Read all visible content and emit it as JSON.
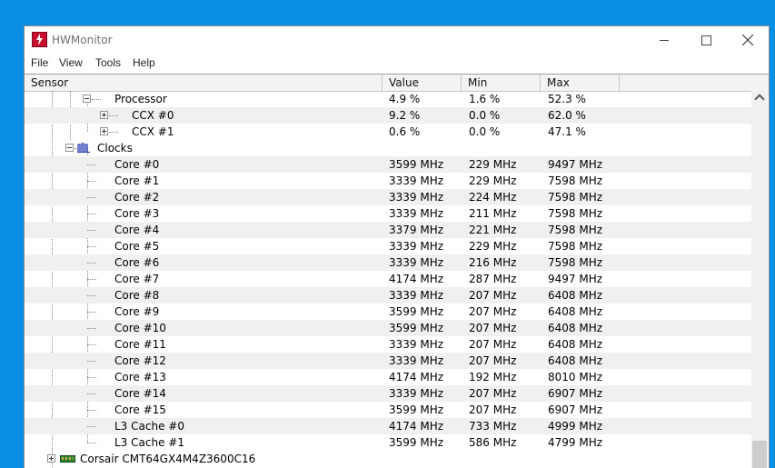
{
  "window": {
    "title": "HWMonitor"
  },
  "menu": [
    "File",
    "View",
    "Tools",
    "Help"
  ],
  "columns": {
    "sensor": "Sensor",
    "value": "Value",
    "min": "Min",
    "max": "Max"
  },
  "processor": {
    "label": "Processor",
    "value": "4.9 %",
    "min": "1.6 %",
    "max": "52.3 %"
  },
  "ccx": [
    {
      "label": "CCX #0",
      "value": "9.2 %",
      "min": "0.0 %",
      "max": "62.0 %"
    },
    {
      "label": "CCX #1",
      "value": "0.6 %",
      "min": "0.0 %",
      "max": "47.1 %"
    }
  ],
  "clocks": {
    "label": "Clocks",
    "rows": [
      {
        "label": "Core #0",
        "value": "3599 MHz",
        "min": "229 MHz",
        "max": "9497 MHz"
      },
      {
        "label": "Core #1",
        "value": "3339 MHz",
        "min": "229 MHz",
        "max": "7598 MHz"
      },
      {
        "label": "Core #2",
        "value": "3339 MHz",
        "min": "224 MHz",
        "max": "7598 MHz"
      },
      {
        "label": "Core #3",
        "value": "3339 MHz",
        "min": "211 MHz",
        "max": "7598 MHz"
      },
      {
        "label": "Core #4",
        "value": "3379 MHz",
        "min": "221 MHz",
        "max": "7598 MHz"
      },
      {
        "label": "Core #5",
        "value": "3339 MHz",
        "min": "229 MHz",
        "max": "7598 MHz"
      },
      {
        "label": "Core #6",
        "value": "3339 MHz",
        "min": "216 MHz",
        "max": "7598 MHz"
      },
      {
        "label": "Core #7",
        "value": "4174 MHz",
        "min": "287 MHz",
        "max": "9497 MHz"
      },
      {
        "label": "Core #8",
        "value": "3339 MHz",
        "min": "207 MHz",
        "max": "6408 MHz"
      },
      {
        "label": "Core #9",
        "value": "3599 MHz",
        "min": "207 MHz",
        "max": "6408 MHz"
      },
      {
        "label": "Core #10",
        "value": "3599 MHz",
        "min": "207 MHz",
        "max": "6408 MHz"
      },
      {
        "label": "Core #11",
        "value": "3339 MHz",
        "min": "207 MHz",
        "max": "6408 MHz"
      },
      {
        "label": "Core #12",
        "value": "3339 MHz",
        "min": "207 MHz",
        "max": "6408 MHz"
      },
      {
        "label": "Core #13",
        "value": "4174 MHz",
        "min": "192 MHz",
        "max": "8010 MHz"
      },
      {
        "label": "Core #14",
        "value": "3339 MHz",
        "min": "207 MHz",
        "max": "6907 MHz"
      },
      {
        "label": "Core #15",
        "value": "3599 MHz",
        "min": "207 MHz",
        "max": "6907 MHz"
      },
      {
        "label": "L3 Cache #0",
        "value": "4174 MHz",
        "min": "733 MHz",
        "max": "4999 MHz"
      },
      {
        "label": "L3 Cache #1",
        "value": "3599 MHz",
        "min": "586 MHz",
        "max": "4799 MHz"
      }
    ]
  },
  "memory": {
    "label": "Corsair CMT64GX4M4Z3600C16"
  },
  "icons": {
    "app": "hwmonitor-logo-icon",
    "clock": "clock-bars-icon",
    "memory": "ram-module-icon"
  }
}
